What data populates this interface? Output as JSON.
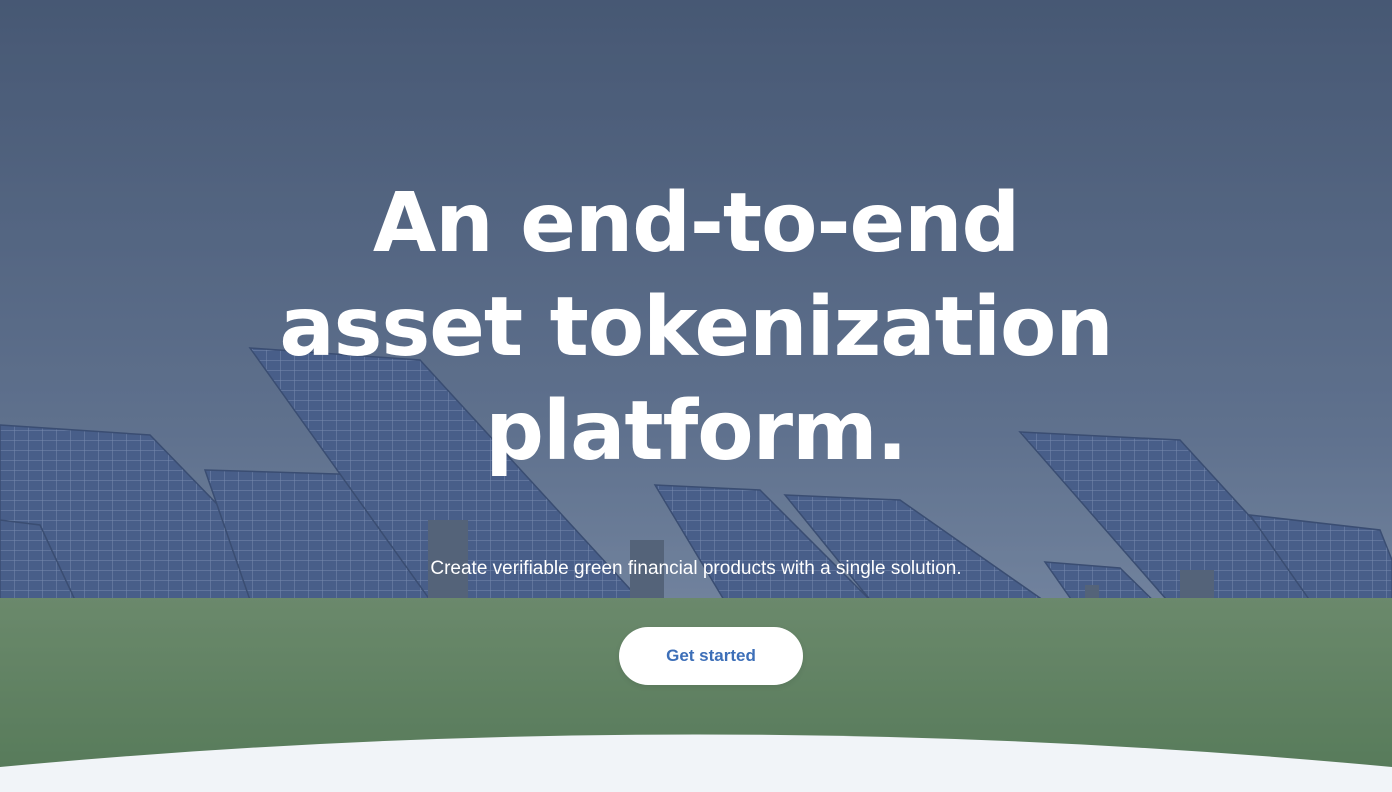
{
  "hero": {
    "headline": [
      "An end-to-end",
      "asset tokenization",
      "platform."
    ],
    "subtitle": "Create verifiable green financial products with a single solution.",
    "cta_label": "Get started"
  },
  "colors": {
    "sky_top": "#4b5c76",
    "sky_bottom": "#8a9bb3",
    "grass": "#6f9a5e",
    "panel": "#4d6594",
    "cta_text": "#3d6fb8",
    "section_bg": "#f1f4f8"
  }
}
